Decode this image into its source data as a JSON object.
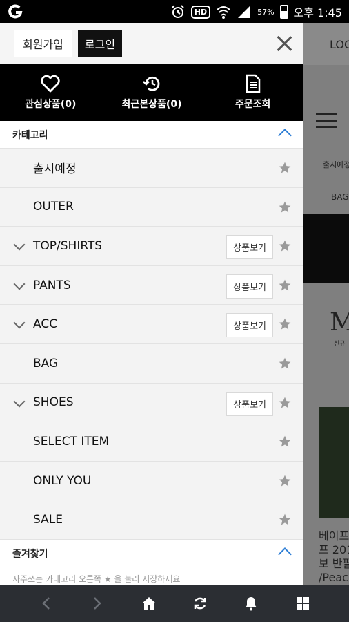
{
  "status_bar": {
    "battery": "57%",
    "time": "오후 1:45",
    "hd": "HD",
    "icons": [
      "carrier-icon",
      "alarm-icon",
      "hd-icon",
      "wifi-icon",
      "signal-icon",
      "battery-icon"
    ]
  },
  "background_page": {
    "top_text": "LOG",
    "nav_text": "출시예정",
    "nav_text2": "BAG",
    "brand_letter": "M",
    "brand_sub": "신규",
    "caption_lines": [
      "베이프",
      "프 201",
      "보 반팔",
      "/Peac"
    ]
  },
  "drawer": {
    "join_label": "회원가입",
    "login_label": "로그인",
    "quick": [
      {
        "icon": "heart-icon",
        "label": "관심상품(0)"
      },
      {
        "icon": "history-icon",
        "label": "최근본상품(0)"
      },
      {
        "icon": "document-icon",
        "label": "주문조회"
      }
    ],
    "category_title": "카테고리",
    "categories": [
      {
        "label": "출시예정",
        "expandable": false,
        "view": ""
      },
      {
        "label": "OUTER",
        "expandable": false,
        "view": ""
      },
      {
        "label": "TOP/SHIRTS",
        "expandable": true,
        "view": "상품보기"
      },
      {
        "label": "PANTS",
        "expandable": true,
        "view": "상품보기"
      },
      {
        "label": "ACC",
        "expandable": true,
        "view": "상품보기"
      },
      {
        "label": "BAG",
        "expandable": false,
        "view": ""
      },
      {
        "label": "SHOES",
        "expandable": true,
        "view": "상품보기"
      },
      {
        "label": "SELECT ITEM",
        "expandable": false,
        "view": ""
      },
      {
        "label": "ONLY YOU",
        "expandable": false,
        "view": ""
      },
      {
        "label": "SALE",
        "expandable": false,
        "view": ""
      }
    ],
    "favorites_title": "즐겨찾기",
    "favorites_note": "자주쓰는 카테고리 오른쪽 ★ 을 눌러 저장하세요"
  },
  "bottom_bar": {
    "buttons": [
      "back-icon",
      "forward-icon",
      "home-icon",
      "refresh-icon",
      "bell-icon",
      "tabs-icon"
    ]
  },
  "colors": {
    "accent": "#2f7fd6",
    "quickbar_bg": "#000000",
    "bottombar_bg": "#2b2e33"
  }
}
